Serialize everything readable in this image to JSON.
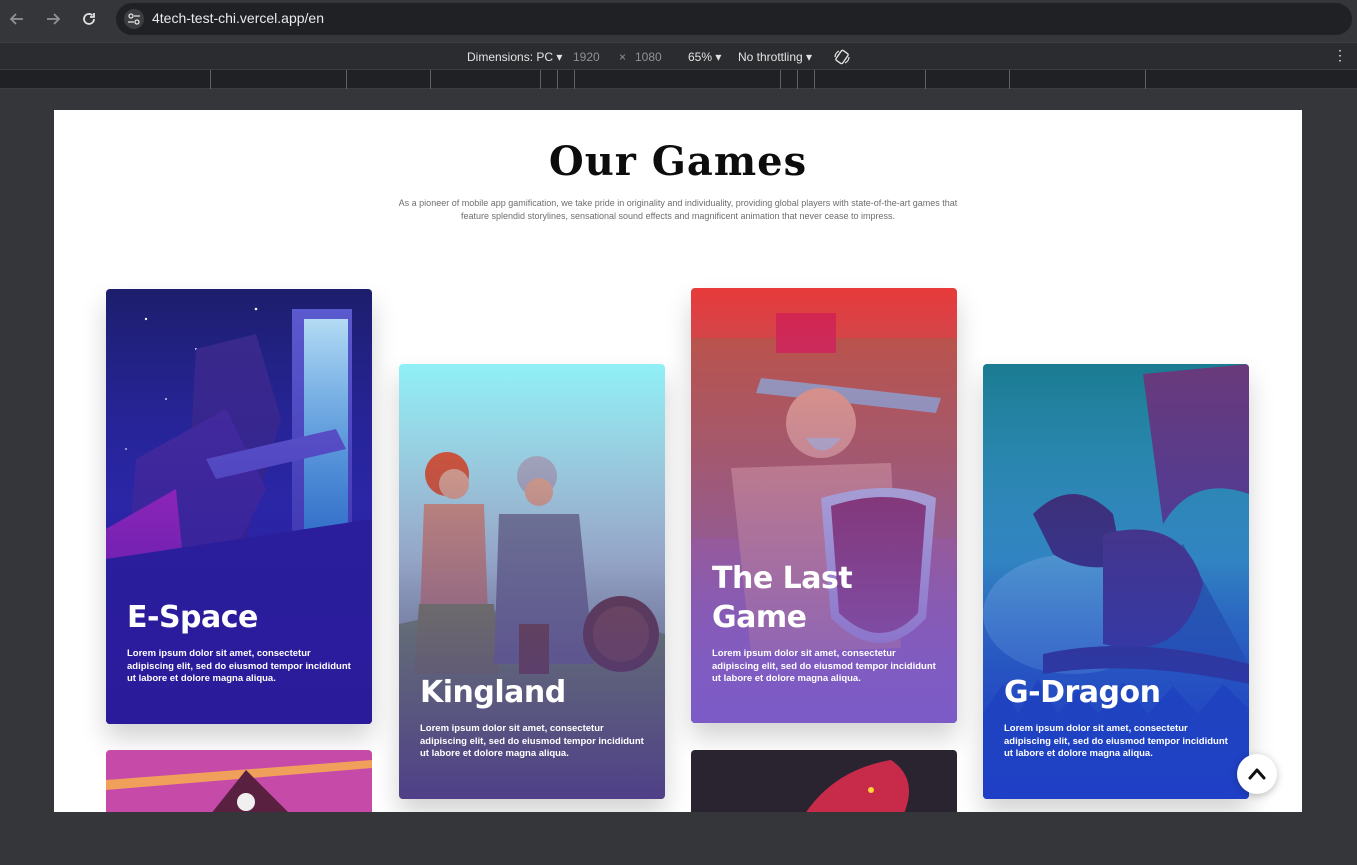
{
  "browser": {
    "url": "4tech-test-chi.vercel.app/en"
  },
  "devtools": {
    "dimensions_label": "Dimensions: PC",
    "width": "1920",
    "height": "1080",
    "times": "×",
    "zoom": "65%",
    "throttling": "No throttling"
  },
  "page": {
    "title": "Our Games",
    "subtitle": "As a pioneer of mobile app gamification, we take pride in originality and individuality, providing global players with state-of-the-art games that feature splendid storylines, sensational sound effects and magnificent animation that never cease to impress.",
    "cards": [
      {
        "title": "E-Space",
        "desc": "Lorem ipsum dolor sit amet, consectetur adipiscing elit, sed do eiusmod tempor incididunt ut labore et dolore magna aliqua."
      },
      {
        "title": "Kingland",
        "desc": "Lorem ipsum dolor sit amet, consectetur adipiscing elit, sed do eiusmod tempor incididunt ut labore et dolore magna aliqua."
      },
      {
        "title": "The Last Game",
        "desc": "Lorem ipsum dolor sit amet, consectetur adipiscing elit, sed do eiusmod tempor incididunt ut labore et dolore magna aliqua."
      },
      {
        "title": "G-Dragon",
        "desc": "Lorem ipsum dolor sit amet, consectetur adipiscing elit, sed do eiusmod tempor incididunt ut labore et dolore magna aliqua."
      }
    ]
  },
  "icons": {
    "back": "arrow-left-icon",
    "forward": "arrow-right-icon",
    "reload": "reload-icon",
    "site_info": "tune-icon",
    "rotate": "rotate-icon",
    "menu": "kebab-icon",
    "scroll_top": "chevron-up-icon"
  }
}
